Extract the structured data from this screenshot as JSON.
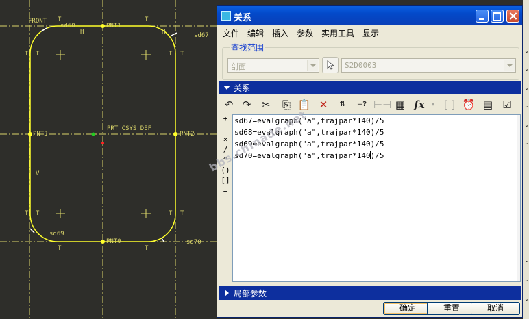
{
  "cad": {
    "labels": {
      "front": "FRONT",
      "sd60": "sd60",
      "sd67": "sd67",
      "sd69": "sd69",
      "sd70": "sd70",
      "pnt1": "PNT1",
      "pnt0": "PNT0",
      "pnt3": "PNT3",
      "pnt2": "PNT2",
      "csys": "PRT_CSYS_DEF",
      "h_top": "H",
      "h_right": "H",
      "v_left": "V",
      "t": "T"
    },
    "colors": {
      "background": "#2e2e2a",
      "geometry": "#ffff2a",
      "datum": "#d9d46a",
      "csys_point": "#22cc22",
      "origin": "#ff2222"
    }
  },
  "dialog": {
    "title": "关系",
    "menu": [
      "文件",
      "编辑",
      "插入",
      "参数",
      "实用工具",
      "显示"
    ],
    "scope": {
      "label": "查找范围",
      "type_value": "剖面",
      "object_value": "S2D0003"
    },
    "relations_section": "关系",
    "toolbar_icons": [
      "undo-icon",
      "redo-icon",
      "cut-icon",
      "copy-icon",
      "paste-icon",
      "delete-icon",
      "switch-dimensions-icon",
      "evaluate-icon",
      "sort-icon",
      "verify-icon",
      "function-icon",
      "brackets-icon",
      "unit-sensitive-icon",
      "show-dimensions-icon",
      "verify-relations-icon"
    ],
    "operators": [
      "+",
      "−",
      "×",
      "/",
      "^",
      "()",
      "[]",
      "="
    ],
    "relations": [
      "sd67=evalgraph(\"a\",trajpar*140)/5",
      "sd68=evalgraph(\"a\",trajpar*140)/5",
      "sd69=evalgraph(\"a\",trajpar*140)/5",
      "sd70=evalgraph(\"a\",trajpar*140)/5"
    ],
    "local_params_section": "局部参数",
    "buttons": {
      "ok": "确定",
      "reset": "重置",
      "cancel": "取消"
    },
    "colors": {
      "title_bar": "#0a4fd0",
      "section_bar": "#0d2f9e",
      "scope_label": "#1941d0"
    }
  },
  "watermark": "bbs.chinade.net"
}
